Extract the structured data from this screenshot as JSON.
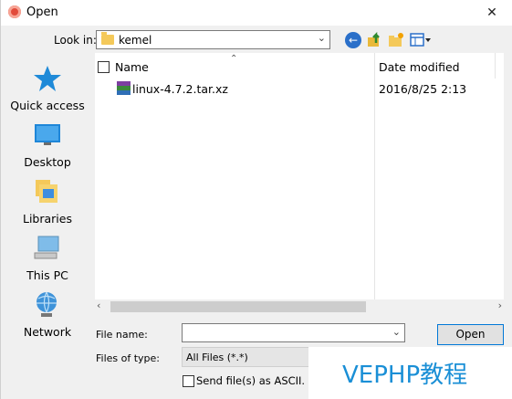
{
  "window": {
    "title": "Open",
    "close_glyph": "✕"
  },
  "lookin": {
    "label": "Look in:",
    "value": "kemel"
  },
  "places": [
    {
      "label": "Quick access",
      "icon": "star-icon"
    },
    {
      "label": "Desktop",
      "icon": "desktop-icon"
    },
    {
      "label": "Libraries",
      "icon": "libraries-icon"
    },
    {
      "label": "This PC",
      "icon": "computer-icon"
    },
    {
      "label": "Network",
      "icon": "network-icon"
    }
  ],
  "filelist": {
    "columns": {
      "name": "Name",
      "date": "Date modified"
    },
    "files": [
      {
        "name": "linux-4.7.2.tar.xz",
        "date": "2016/8/25 2:13",
        "icon": "archive-icon"
      }
    ]
  },
  "filename": {
    "label": "File name:",
    "value": ""
  },
  "filetype": {
    "label": "Files of type:",
    "value": "All Files (*.*)"
  },
  "open_button": "Open",
  "ascii": {
    "label": "Send file(s) as ASCII.",
    "checked": false
  },
  "watermark": "VEPHP教程"
}
